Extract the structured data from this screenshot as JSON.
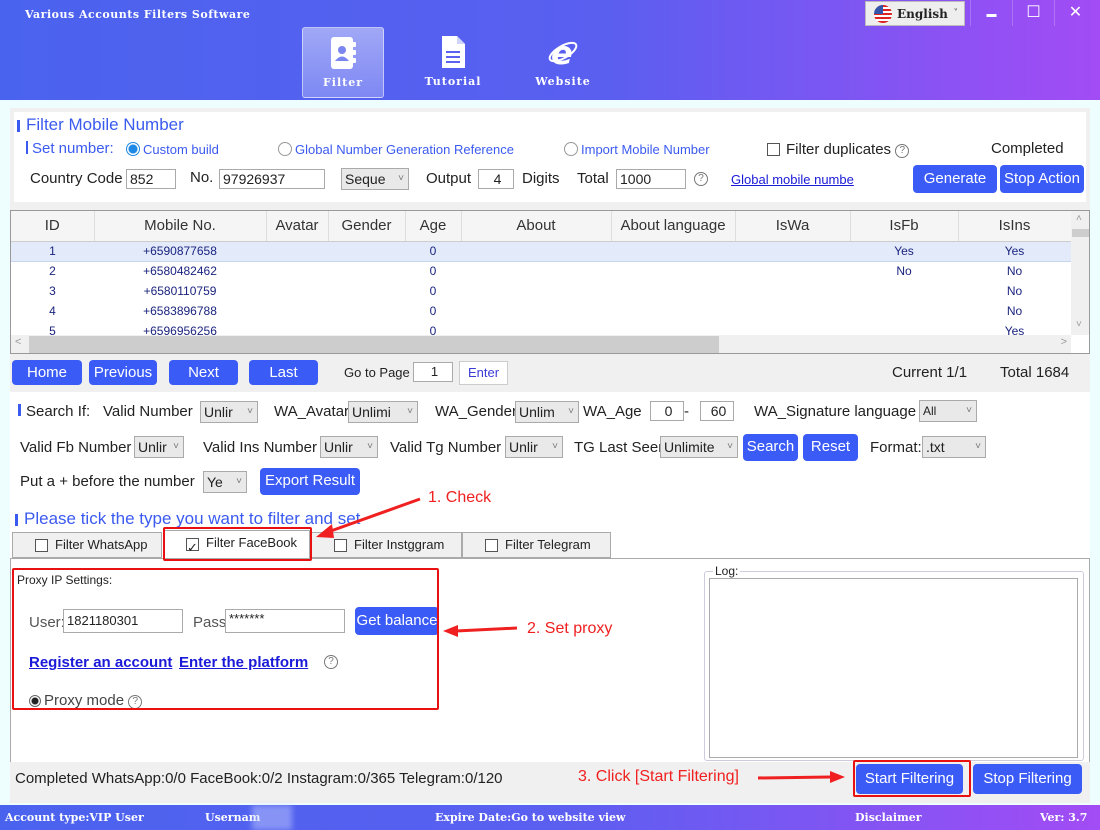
{
  "app": {
    "title": "Various Accounts Filters Software"
  },
  "nav": [
    {
      "label": "Filter",
      "icon": "contacts-book-icon",
      "active": true
    },
    {
      "label": "Tutorial",
      "icon": "document-icon",
      "active": false
    },
    {
      "label": "Website",
      "icon": "internet-explorer-icon",
      "active": false
    }
  ],
  "language": {
    "selected": "English",
    "icon": "us-flag-icon"
  },
  "window_controls": {
    "minimize": "▬",
    "maximize": "☐",
    "close": "✕"
  },
  "generator": {
    "title": "Filter Mobile Number",
    "set_number_label": "Set number:",
    "modes": [
      {
        "label": "Custom build",
        "selected": true
      },
      {
        "label": "Global Number Generation Reference",
        "selected": false
      },
      {
        "label": "Import Mobile Number",
        "selected": false
      }
    ],
    "filter_duplicates_label": "Filter duplicates",
    "filter_duplicates_checked": false,
    "status": "Completed",
    "country_code_label": "Country Code",
    "country_code": "852",
    "no_label": "No.",
    "no_value": "97926937",
    "order_select": "Seque",
    "output_label": "Output",
    "output_value": "4",
    "digits_label": "Digits",
    "total_label": "Total",
    "total_value": "1000",
    "global_link": "Global mobile numbe",
    "generate_button": "Generate",
    "stop_button": "Stop Action"
  },
  "table": {
    "columns": [
      "ID",
      "Mobile No.",
      "Avatar",
      "Gender",
      "Age",
      "About",
      "About language",
      "IsWa",
      "IsFb",
      "IsIns"
    ],
    "rows": [
      {
        "id": "1",
        "mobile": "+6590877658",
        "avatar": "",
        "gender": "",
        "age": "0",
        "about": "",
        "about_lang": "",
        "iswa": "",
        "isfb": "Yes",
        "isins": "Yes"
      },
      {
        "id": "2",
        "mobile": "+6580482462",
        "avatar": "",
        "gender": "",
        "age": "0",
        "about": "",
        "about_lang": "",
        "iswa": "",
        "isfb": "No",
        "isins": "No"
      },
      {
        "id": "3",
        "mobile": "+6580110759",
        "avatar": "",
        "gender": "",
        "age": "0",
        "about": "",
        "about_lang": "",
        "iswa": "",
        "isfb": "",
        "isins": "No"
      },
      {
        "id": "4",
        "mobile": "+6583896788",
        "avatar": "",
        "gender": "",
        "age": "0",
        "about": "",
        "about_lang": "",
        "iswa": "",
        "isfb": "",
        "isins": "No"
      },
      {
        "id": "5",
        "mobile": "+6596956256",
        "avatar": "",
        "gender": "",
        "age": "0",
        "about": "",
        "about_lang": "",
        "iswa": "",
        "isfb": "",
        "isins": "Yes"
      }
    ]
  },
  "pagination": {
    "home": "Home",
    "previous": "Previous",
    "next": "Next",
    "last": "Last",
    "goto_label": "Go to Page",
    "goto_value": "1",
    "enter": "Enter",
    "current": "Current 1/1",
    "total": "Total 1684"
  },
  "search": {
    "label": "Search If:",
    "valid_number_label": "Valid Number",
    "valid_number": "Unlir",
    "wa_avatar_label": "WA_Avatar",
    "wa_avatar": "Unlimi",
    "wa_gender_label": "WA_Gender",
    "wa_gender": "Unlim",
    "wa_age_label": "WA_Age",
    "wa_age_min": "0",
    "wa_age_sep": "-",
    "wa_age_max": "60",
    "wa_sig_label": "WA_Signature language",
    "wa_sig": "All",
    "valid_fb_label": "Valid Fb Number",
    "valid_fb": "Unlir",
    "valid_ins_label": "Valid Ins Number",
    "valid_ins": "Unlir",
    "valid_tg_label": "Valid Tg Number",
    "valid_tg": "Unlir",
    "tg_last_seen_label": "TG Last Seen",
    "tg_last_seen": "Unlimite",
    "search_button": "Search",
    "reset_button": "Reset",
    "format_label": "Format:",
    "format": ".txt",
    "plus_label": "Put a + before the number",
    "plus": "Ye",
    "export_button": "Export Result"
  },
  "filter_types": {
    "title": "Please tick the type you want to filter and set",
    "tabs": [
      {
        "label": "Filter WhatsApp",
        "checked": false
      },
      {
        "label": "Filter FaceBook",
        "checked": true
      },
      {
        "label": "Filter Instggram",
        "checked": false
      },
      {
        "label": "Filter Telegram",
        "checked": false
      }
    ]
  },
  "proxy": {
    "title": "Proxy IP Settings:",
    "user_label": "User:",
    "user": "1821180301",
    "pass_label": "Pass:",
    "pass": "*******",
    "balance_button": "Get balance",
    "register_link": "Register an account",
    "platform_link": "Enter the platform",
    "mode_label": "Proxy mode"
  },
  "log": {
    "label": "Log:",
    "content": ""
  },
  "progress": {
    "text": "Completed WhatsApp:0/0 FaceBook:0/2 Instagram:0/365 Telegram:0/120"
  },
  "actions": {
    "start": "Start Filtering",
    "stop": "Stop Filtering"
  },
  "annotations": {
    "step1": "1. Check",
    "step2": "2. Set proxy",
    "step3": "3. Click [Start Filtering]"
  },
  "footer": {
    "account_type": "Account type:VIP User",
    "username": "Usernam",
    "expire": "Expire Date:Go to website view",
    "disclaimer": "Disclaimer",
    "version": "Ver: 3.7"
  },
  "colors": {
    "accent": "#3b5bf7",
    "annotation": "#f02020",
    "header_start": "#4a63ee",
    "header_end": "#a24cf5"
  }
}
